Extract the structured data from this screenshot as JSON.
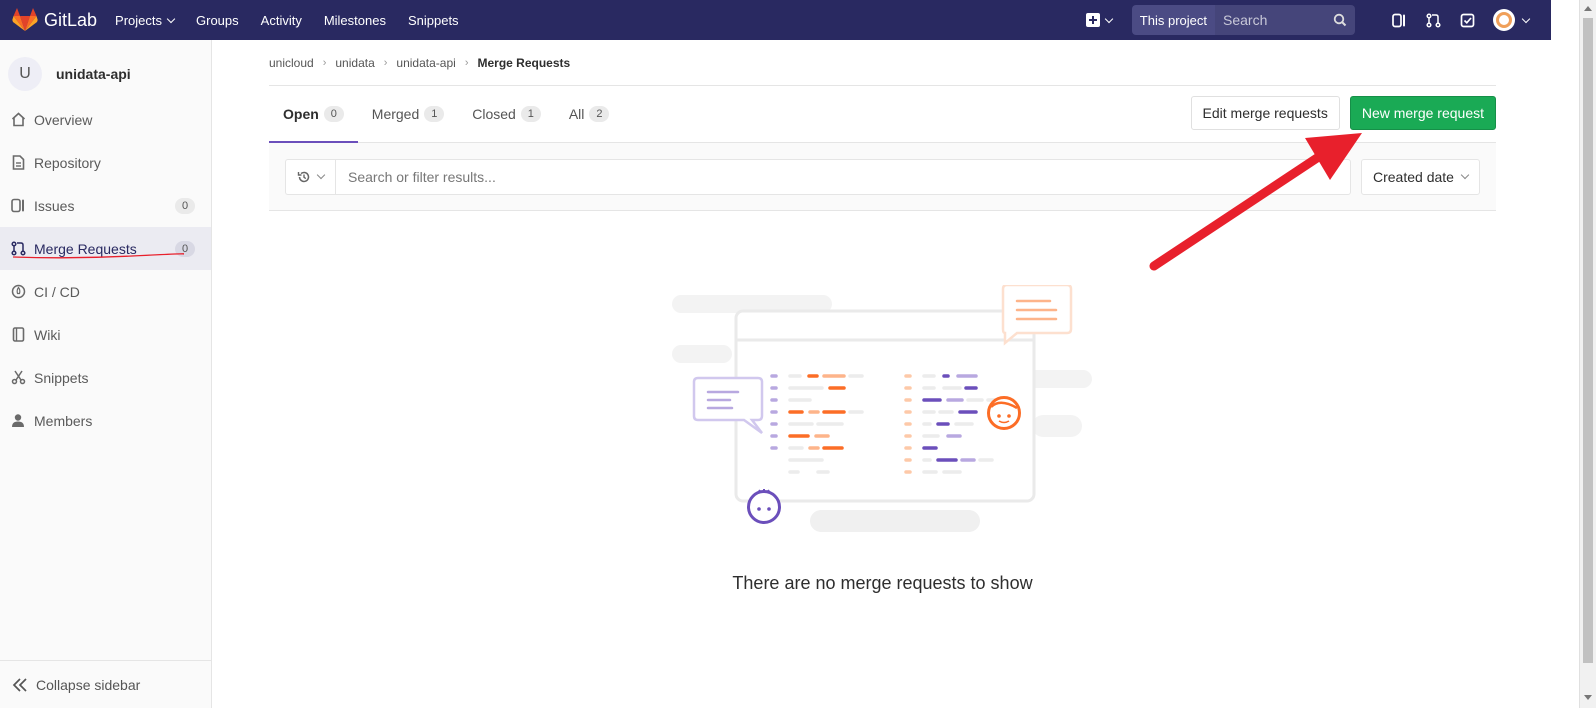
{
  "navbar": {
    "brand": "GitLab",
    "links": [
      {
        "label": "Projects",
        "dropdown": true
      },
      {
        "label": "Groups"
      },
      {
        "label": "Activity"
      },
      {
        "label": "Milestones"
      },
      {
        "label": "Snippets"
      }
    ],
    "search_scope": "This project",
    "search_placeholder": "Search"
  },
  "sidebar": {
    "project_initial": "U",
    "project_name": "unidata-api",
    "items": [
      {
        "label": "Overview",
        "icon": "home-icon"
      },
      {
        "label": "Repository",
        "icon": "document-icon"
      },
      {
        "label": "Issues",
        "icon": "issues-icon",
        "count": "0"
      },
      {
        "label": "Merge Requests",
        "icon": "merge-request-icon",
        "count": "0",
        "active": true
      },
      {
        "label": "CI / CD",
        "icon": "rocket-icon"
      },
      {
        "label": "Wiki",
        "icon": "book-icon"
      },
      {
        "label": "Snippets",
        "icon": "scissors-icon"
      },
      {
        "label": "Members",
        "icon": "user-icon"
      }
    ],
    "collapse_label": "Collapse sidebar"
  },
  "breadcrumbs": [
    "unicloud",
    "unidata",
    "unidata-api",
    "Merge Requests"
  ],
  "tabs": [
    {
      "label": "Open",
      "count": "0",
      "active": true
    },
    {
      "label": "Merged",
      "count": "1"
    },
    {
      "label": "Closed",
      "count": "1"
    },
    {
      "label": "All",
      "count": "2"
    }
  ],
  "actions": {
    "edit_label": "Edit merge requests",
    "new_label": "New merge request"
  },
  "filter": {
    "placeholder": "Search or filter results...",
    "sort_label": "Created date"
  },
  "empty_state": {
    "message": "There are no merge requests to show"
  },
  "colors": {
    "navbar": "#292961",
    "accent": "#6b4fbb",
    "primary_button": "#1aaa55",
    "annotation": "#e8202c"
  }
}
